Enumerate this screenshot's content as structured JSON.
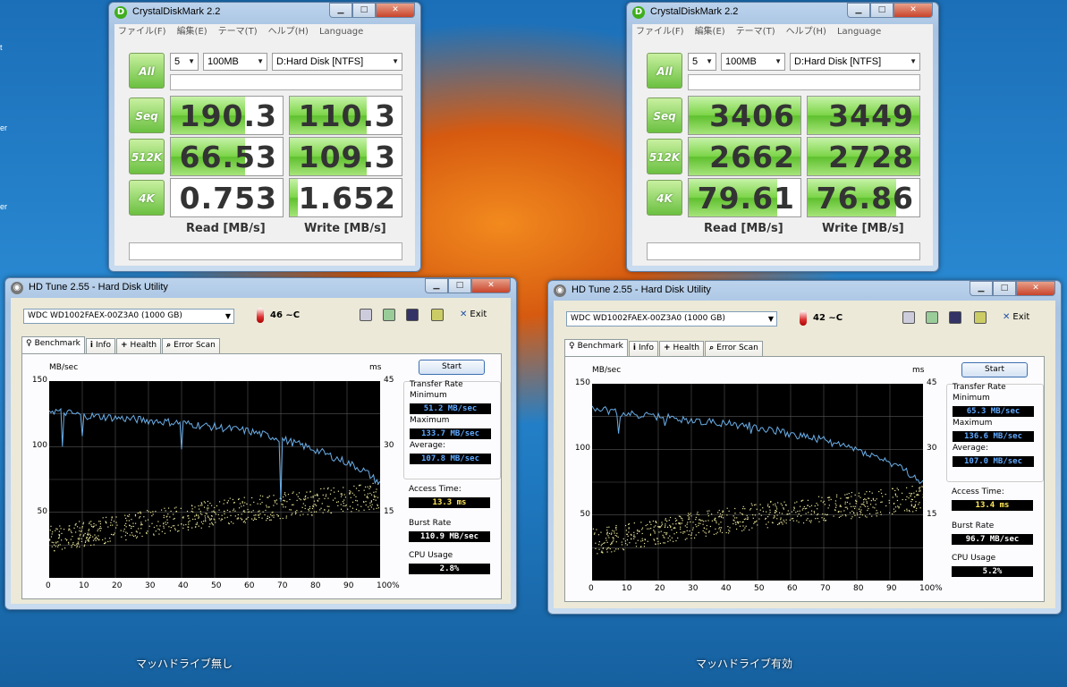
{
  "desktop": {
    "side_texts": [
      "t",
      "er",
      "er"
    ]
  },
  "captions": [
    "マッハドライブ無し",
    "マッハドライブ有効"
  ],
  "cdm": [
    {
      "title": "CrystalDiskMark 2.2",
      "menu": [
        "ファイル(F)",
        "編集(E)",
        "テーマ(T)",
        "ヘルプ(H)",
        "Language"
      ],
      "all_label": "All",
      "count": "5",
      "size": "100MB",
      "drive": "D:Hard Disk [NTFS]",
      "rows": [
        {
          "label": "Seq",
          "read": "190.3",
          "write": "110.3",
          "read_fill": 0.66,
          "write_fill": 0.69
        },
        {
          "label": "512K",
          "read": "66.53",
          "write": "109.3",
          "read_fill": 0.66,
          "write_fill": 0.69
        },
        {
          "label": "4K",
          "read": "0.753",
          "write": "1.652",
          "read_fill": 0,
          "write_fill": 0.07
        }
      ],
      "read_header": "Read [MB/s]",
      "write_header": "Write [MB/s]"
    },
    {
      "title": "CrystalDiskMark 2.2",
      "menu": [
        "ファイル(F)",
        "編集(E)",
        "テーマ(T)",
        "ヘルプ(H)",
        "Language"
      ],
      "all_label": "All",
      "count": "5",
      "size": "100MB",
      "drive": "D:Hard Disk [NTFS]",
      "rows": [
        {
          "label": "Seq",
          "read": "3406",
          "write": "3449",
          "read_fill": 1,
          "write_fill": 1
        },
        {
          "label": "512K",
          "read": "2662",
          "write": "2728",
          "read_fill": 1,
          "write_fill": 1
        },
        {
          "label": "4K",
          "read": "79.61",
          "write": "76.86",
          "read_fill": 0.79,
          "write_fill": 0.79
        }
      ],
      "read_header": "Read [MB/s]",
      "write_header": "Write [MB/s]"
    }
  ],
  "hdtune": [
    {
      "title": "HD Tune 2.55 - Hard Disk Utility",
      "drive": "WDC WD1002FAEX-00Z3A0 (1000 GB)",
      "temp": "46 ~C",
      "exit": "Exit",
      "tabs": [
        "Benchmark",
        "Info",
        "Health",
        "Error Scan"
      ],
      "start": "Start",
      "left_unit": "MB/sec",
      "right_unit": "ms",
      "y_left": [
        "150",
        "100",
        "50"
      ],
      "y_right": [
        "45",
        "30",
        "15"
      ],
      "x_ticks": [
        "0",
        "10",
        "20",
        "30",
        "40",
        "50",
        "60",
        "70",
        "80",
        "90",
        "100%"
      ],
      "labels": {
        "transfer": "Transfer Rate",
        "min": "Minimum",
        "max": "Maximum",
        "avg": "Average:",
        "access": "Access Time:",
        "burst": "Burst Rate",
        "cpu": "CPU Usage"
      },
      "values": {
        "min": "51.2 MB/sec",
        "max": "133.7 MB/sec",
        "avg": "107.8 MB/sec",
        "access": "13.3 ms",
        "burst": "110.9 MB/sec",
        "cpu": "2.8%"
      },
      "chart_data": {
        "type": "line",
        "x_range": [
          0,
          100
        ],
        "ylim": [
          0,
          150
        ],
        "y2lim": [
          0,
          45
        ],
        "series": [
          {
            "x": [
              0,
              5,
              10,
              20,
              30,
              40,
              50,
              60,
              70,
              80,
              90,
              95,
              100
            ],
            "values": [
              128,
              126,
              124,
              122,
              120,
              118,
              115,
              112,
              106,
              98,
              88,
              82,
              72
            ]
          }
        ],
        "dips": [
          [
            4,
            100
          ],
          [
            10,
            108
          ],
          [
            40,
            98
          ],
          [
            70,
            58
          ]
        ],
        "access_band": [
          [
            0,
            6,
            12
          ],
          [
            50,
            12,
            18
          ],
          [
            100,
            16,
            22
          ]
        ]
      }
    },
    {
      "title": "HD Tune 2.55 - Hard Disk Utility",
      "drive": "WDC WD1002FAEX-00Z3A0 (1000 GB)",
      "temp": "42 ~C",
      "exit": "Exit",
      "tabs": [
        "Benchmark",
        "Info",
        "Health",
        "Error Scan"
      ],
      "start": "Start",
      "left_unit": "MB/sec",
      "right_unit": "ms",
      "y_left": [
        "150",
        "100",
        "50"
      ],
      "y_right": [
        "45",
        "30",
        "15"
      ],
      "x_ticks": [
        "0",
        "10",
        "20",
        "30",
        "40",
        "50",
        "60",
        "70",
        "80",
        "90",
        "100%"
      ],
      "labels": {
        "transfer": "Transfer Rate",
        "min": "Minimum",
        "max": "Maximum",
        "avg": "Average:",
        "access": "Access Time:",
        "burst": "Burst Rate",
        "cpu": "CPU Usage"
      },
      "values": {
        "min": "65.3 MB/sec",
        "max": "136.6 MB/sec",
        "avg": "107.0 MB/sec",
        "access": "13.4 ms",
        "burst": "96.7 MB/sec",
        "cpu": "5.2%"
      },
      "chart_data": {
        "type": "line",
        "x_range": [
          0,
          100
        ],
        "ylim": [
          0,
          150
        ],
        "y2lim": [
          0,
          45
        ],
        "series": [
          {
            "x": [
              0,
              5,
              10,
              20,
              30,
              40,
              50,
              60,
              70,
              80,
              90,
              95,
              100
            ],
            "values": [
              132,
              129,
              127,
              125,
              122,
              120,
              117,
              112,
              107,
              100,
              90,
              83,
              74
            ]
          }
        ],
        "dips": [
          [
            8,
            112
          ],
          [
            22,
            118
          ],
          [
            48,
            112
          ],
          [
            62,
            108
          ]
        ],
        "access_band": [
          [
            0,
            6,
            12
          ],
          [
            50,
            12,
            18
          ],
          [
            100,
            16,
            22
          ]
        ]
      }
    }
  ]
}
